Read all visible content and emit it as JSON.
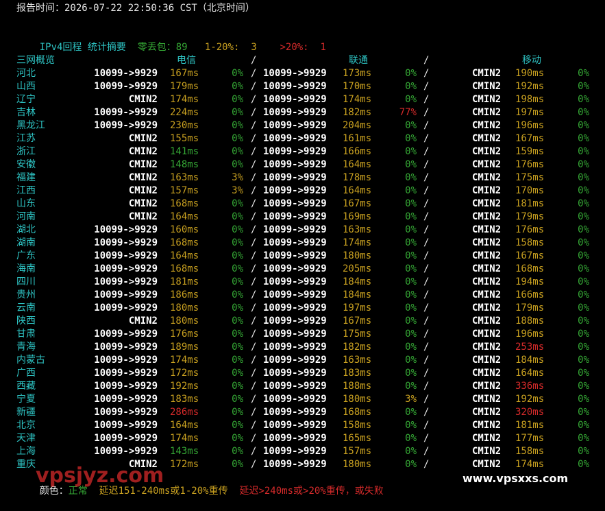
{
  "report_time": "报告时间：2026-07-22 22:50:36 CST（北京时间）",
  "summary": {
    "title": "IPv4回程 统计摘要",
    "zero_loss": "零丢包：89",
    "mid_loss": "1-20%:  3",
    "high_loss": ">20%:  1"
  },
  "header": {
    "overview": "三网概览",
    "telecom": "电信",
    "unicom": "联通",
    "mobile": "移动",
    "sep": "/"
  },
  "colors": {
    "background": "#000000",
    "cyan": "#2ec4c4",
    "green": "#35a835",
    "yellow": "#c8a020",
    "red": "#d42a2a",
    "white": "#ffffff"
  },
  "rows": [
    {
      "prov": "河北",
      "t_route": "10099->9929",
      "t_ms": "167ms",
      "t_ms_c": "yellow",
      "t_loss": "0%",
      "t_loss_c": "green",
      "u_route": "10099->9929",
      "u_ms": "173ms",
      "u_ms_c": "yellow",
      "u_loss": "0%",
      "u_loss_c": "green",
      "m_route": "CMIN2",
      "m_ms": "190ms",
      "m_ms_c": "yellow",
      "m_loss": "0%",
      "m_loss_c": "green"
    },
    {
      "prov": "山西",
      "t_route": "10099->9929",
      "t_ms": "179ms",
      "t_ms_c": "yellow",
      "t_loss": "0%",
      "t_loss_c": "green",
      "u_route": "10099->9929",
      "u_ms": "170ms",
      "u_ms_c": "yellow",
      "u_loss": "0%",
      "u_loss_c": "green",
      "m_route": "CMIN2",
      "m_ms": "192ms",
      "m_ms_c": "yellow",
      "m_loss": "0%",
      "m_loss_c": "green"
    },
    {
      "prov": "辽宁",
      "t_route": "CMIN2",
      "t_ms": "174ms",
      "t_ms_c": "yellow",
      "t_loss": "0%",
      "t_loss_c": "green",
      "u_route": "10099->9929",
      "u_ms": "174ms",
      "u_ms_c": "yellow",
      "u_loss": "0%",
      "u_loss_c": "green",
      "m_route": "CMIN2",
      "m_ms": "198ms",
      "m_ms_c": "yellow",
      "m_loss": "0%",
      "m_loss_c": "green"
    },
    {
      "prov": "吉林",
      "t_route": "10099->9929",
      "t_ms": "224ms",
      "t_ms_c": "yellow",
      "t_loss": "0%",
      "t_loss_c": "green",
      "u_route": "10099->9929",
      "u_ms": "182ms",
      "u_ms_c": "yellow",
      "u_loss": "77%",
      "u_loss_c": "red",
      "m_route": "CMIN2",
      "m_ms": "197ms",
      "m_ms_c": "yellow",
      "m_loss": "0%",
      "m_loss_c": "green"
    },
    {
      "prov": "黑龙江",
      "t_route": "10099->9929",
      "t_ms": "230ms",
      "t_ms_c": "yellow",
      "t_loss": "0%",
      "t_loss_c": "green",
      "u_route": "10099->9929",
      "u_ms": "204ms",
      "u_ms_c": "yellow",
      "u_loss": "0%",
      "u_loss_c": "green",
      "m_route": "CMIN2",
      "m_ms": "196ms",
      "m_ms_c": "yellow",
      "m_loss": "0%",
      "m_loss_c": "green"
    },
    {
      "prov": "江苏",
      "t_route": "CMIN2",
      "t_ms": "155ms",
      "t_ms_c": "yellow",
      "t_loss": "0%",
      "t_loss_c": "green",
      "u_route": "10099->9929",
      "u_ms": "161ms",
      "u_ms_c": "yellow",
      "u_loss": "0%",
      "u_loss_c": "green",
      "m_route": "CMIN2",
      "m_ms": "167ms",
      "m_ms_c": "yellow",
      "m_loss": "0%",
      "m_loss_c": "green"
    },
    {
      "prov": "浙江",
      "t_route": "CMIN2",
      "t_ms": "141ms",
      "t_ms_c": "green",
      "t_loss": "0%",
      "t_loss_c": "green",
      "u_route": "10099->9929",
      "u_ms": "166ms",
      "u_ms_c": "yellow",
      "u_loss": "0%",
      "u_loss_c": "green",
      "m_route": "CMIN2",
      "m_ms": "159ms",
      "m_ms_c": "yellow",
      "m_loss": "0%",
      "m_loss_c": "green"
    },
    {
      "prov": "安徽",
      "t_route": "CMIN2",
      "t_ms": "148ms",
      "t_ms_c": "green",
      "t_loss": "0%",
      "t_loss_c": "green",
      "u_route": "10099->9929",
      "u_ms": "164ms",
      "u_ms_c": "yellow",
      "u_loss": "0%",
      "u_loss_c": "green",
      "m_route": "CMIN2",
      "m_ms": "176ms",
      "m_ms_c": "yellow",
      "m_loss": "0%",
      "m_loss_c": "green"
    },
    {
      "prov": "福建",
      "t_route": "CMIN2",
      "t_ms": "163ms",
      "t_ms_c": "yellow",
      "t_loss": "3%",
      "t_loss_c": "yellow",
      "u_route": "10099->9929",
      "u_ms": "178ms",
      "u_ms_c": "yellow",
      "u_loss": "0%",
      "u_loss_c": "green",
      "m_route": "CMIN2",
      "m_ms": "175ms",
      "m_ms_c": "yellow",
      "m_loss": "0%",
      "m_loss_c": "green"
    },
    {
      "prov": "江西",
      "t_route": "CMIN2",
      "t_ms": "157ms",
      "t_ms_c": "yellow",
      "t_loss": "3%",
      "t_loss_c": "yellow",
      "u_route": "10099->9929",
      "u_ms": "164ms",
      "u_ms_c": "yellow",
      "u_loss": "0%",
      "u_loss_c": "green",
      "m_route": "CMIN2",
      "m_ms": "170ms",
      "m_ms_c": "yellow",
      "m_loss": "0%",
      "m_loss_c": "green"
    },
    {
      "prov": "山东",
      "t_route": "CMIN2",
      "t_ms": "168ms",
      "t_ms_c": "yellow",
      "t_loss": "0%",
      "t_loss_c": "green",
      "u_route": "10099->9929",
      "u_ms": "167ms",
      "u_ms_c": "yellow",
      "u_loss": "0%",
      "u_loss_c": "green",
      "m_route": "CMIN2",
      "m_ms": "181ms",
      "m_ms_c": "yellow",
      "m_loss": "0%",
      "m_loss_c": "green"
    },
    {
      "prov": "河南",
      "t_route": "CMIN2",
      "t_ms": "164ms",
      "t_ms_c": "yellow",
      "t_loss": "0%",
      "t_loss_c": "green",
      "u_route": "10099->9929",
      "u_ms": "169ms",
      "u_ms_c": "yellow",
      "u_loss": "0%",
      "u_loss_c": "green",
      "m_route": "CMIN2",
      "m_ms": "179ms",
      "m_ms_c": "yellow",
      "m_loss": "0%",
      "m_loss_c": "green"
    },
    {
      "prov": "湖北",
      "t_route": "10099->9929",
      "t_ms": "160ms",
      "t_ms_c": "yellow",
      "t_loss": "0%",
      "t_loss_c": "green",
      "u_route": "10099->9929",
      "u_ms": "163ms",
      "u_ms_c": "yellow",
      "u_loss": "0%",
      "u_loss_c": "green",
      "m_route": "CMIN2",
      "m_ms": "176ms",
      "m_ms_c": "yellow",
      "m_loss": "0%",
      "m_loss_c": "green"
    },
    {
      "prov": "湖南",
      "t_route": "10099->9929",
      "t_ms": "168ms",
      "t_ms_c": "yellow",
      "t_loss": "0%",
      "t_loss_c": "green",
      "u_route": "10099->9929",
      "u_ms": "174ms",
      "u_ms_c": "yellow",
      "u_loss": "0%",
      "u_loss_c": "green",
      "m_route": "CMIN2",
      "m_ms": "158ms",
      "m_ms_c": "yellow",
      "m_loss": "0%",
      "m_loss_c": "green"
    },
    {
      "prov": "广东",
      "t_route": "10099->9929",
      "t_ms": "164ms",
      "t_ms_c": "yellow",
      "t_loss": "0%",
      "t_loss_c": "green",
      "u_route": "10099->9929",
      "u_ms": "180ms",
      "u_ms_c": "yellow",
      "u_loss": "0%",
      "u_loss_c": "green",
      "m_route": "CMIN2",
      "m_ms": "167ms",
      "m_ms_c": "yellow",
      "m_loss": "0%",
      "m_loss_c": "green"
    },
    {
      "prov": "海南",
      "t_route": "10099->9929",
      "t_ms": "168ms",
      "t_ms_c": "yellow",
      "t_loss": "0%",
      "t_loss_c": "green",
      "u_route": "10099->9929",
      "u_ms": "205ms",
      "u_ms_c": "yellow",
      "u_loss": "0%",
      "u_loss_c": "green",
      "m_route": "CMIN2",
      "m_ms": "168ms",
      "m_ms_c": "yellow",
      "m_loss": "0%",
      "m_loss_c": "green"
    },
    {
      "prov": "四川",
      "t_route": "10099->9929",
      "t_ms": "181ms",
      "t_ms_c": "yellow",
      "t_loss": "0%",
      "t_loss_c": "green",
      "u_route": "10099->9929",
      "u_ms": "184ms",
      "u_ms_c": "yellow",
      "u_loss": "0%",
      "u_loss_c": "green",
      "m_route": "CMIN2",
      "m_ms": "194ms",
      "m_ms_c": "yellow",
      "m_loss": "0%",
      "m_loss_c": "green"
    },
    {
      "prov": "贵州",
      "t_route": "10099->9929",
      "t_ms": "186ms",
      "t_ms_c": "yellow",
      "t_loss": "0%",
      "t_loss_c": "green",
      "u_route": "10099->9929",
      "u_ms": "184ms",
      "u_ms_c": "yellow",
      "u_loss": "0%",
      "u_loss_c": "green",
      "m_route": "CMIN2",
      "m_ms": "166ms",
      "m_ms_c": "yellow",
      "m_loss": "0%",
      "m_loss_c": "green"
    },
    {
      "prov": "云南",
      "t_route": "10099->9929",
      "t_ms": "180ms",
      "t_ms_c": "yellow",
      "t_loss": "0%",
      "t_loss_c": "green",
      "u_route": "10099->9929",
      "u_ms": "197ms",
      "u_ms_c": "yellow",
      "u_loss": "0%",
      "u_loss_c": "green",
      "m_route": "CMIN2",
      "m_ms": "179ms",
      "m_ms_c": "yellow",
      "m_loss": "0%",
      "m_loss_c": "green"
    },
    {
      "prov": "陕西",
      "t_route": "CMIN2",
      "t_ms": "180ms",
      "t_ms_c": "yellow",
      "t_loss": "0%",
      "t_loss_c": "green",
      "u_route": "10099->9929",
      "u_ms": "167ms",
      "u_ms_c": "yellow",
      "u_loss": "0%",
      "u_loss_c": "green",
      "m_route": "CMIN2",
      "m_ms": "188ms",
      "m_ms_c": "yellow",
      "m_loss": "0%",
      "m_loss_c": "green"
    },
    {
      "prov": "甘肃",
      "t_route": "10099->9929",
      "t_ms": "176ms",
      "t_ms_c": "yellow",
      "t_loss": "0%",
      "t_loss_c": "green",
      "u_route": "10099->9929",
      "u_ms": "175ms",
      "u_ms_c": "yellow",
      "u_loss": "0%",
      "u_loss_c": "green",
      "m_route": "CMIN2",
      "m_ms": "196ms",
      "m_ms_c": "yellow",
      "m_loss": "0%",
      "m_loss_c": "green"
    },
    {
      "prov": "青海",
      "t_route": "10099->9929",
      "t_ms": "189ms",
      "t_ms_c": "yellow",
      "t_loss": "0%",
      "t_loss_c": "green",
      "u_route": "10099->9929",
      "u_ms": "182ms",
      "u_ms_c": "yellow",
      "u_loss": "0%",
      "u_loss_c": "green",
      "m_route": "CMIN2",
      "m_ms": "253ms",
      "m_ms_c": "red",
      "m_loss": "0%",
      "m_loss_c": "green"
    },
    {
      "prov": "内蒙古",
      "t_route": "10099->9929",
      "t_ms": "174ms",
      "t_ms_c": "yellow",
      "t_loss": "0%",
      "t_loss_c": "green",
      "u_route": "10099->9929",
      "u_ms": "163ms",
      "u_ms_c": "yellow",
      "u_loss": "0%",
      "u_loss_c": "green",
      "m_route": "CMIN2",
      "m_ms": "184ms",
      "m_ms_c": "yellow",
      "m_loss": "0%",
      "m_loss_c": "green"
    },
    {
      "prov": "广西",
      "t_route": "10099->9929",
      "t_ms": "172ms",
      "t_ms_c": "yellow",
      "t_loss": "0%",
      "t_loss_c": "green",
      "u_route": "10099->9929",
      "u_ms": "183ms",
      "u_ms_c": "yellow",
      "u_loss": "0%",
      "u_loss_c": "green",
      "m_route": "CMIN2",
      "m_ms": "164ms",
      "m_ms_c": "yellow",
      "m_loss": "0%",
      "m_loss_c": "green"
    },
    {
      "prov": "西藏",
      "t_route": "10099->9929",
      "t_ms": "192ms",
      "t_ms_c": "yellow",
      "t_loss": "0%",
      "t_loss_c": "green",
      "u_route": "10099->9929",
      "u_ms": "188ms",
      "u_ms_c": "yellow",
      "u_loss": "0%",
      "u_loss_c": "green",
      "m_route": "CMIN2",
      "m_ms": "336ms",
      "m_ms_c": "red",
      "m_loss": "0%",
      "m_loss_c": "green"
    },
    {
      "prov": "宁夏",
      "t_route": "10099->9929",
      "t_ms": "183ms",
      "t_ms_c": "yellow",
      "t_loss": "0%",
      "t_loss_c": "green",
      "u_route": "10099->9929",
      "u_ms": "180ms",
      "u_ms_c": "yellow",
      "u_loss": "3%",
      "u_loss_c": "yellow",
      "m_route": "CMIN2",
      "m_ms": "192ms",
      "m_ms_c": "yellow",
      "m_loss": "0%",
      "m_loss_c": "green"
    },
    {
      "prov": "新疆",
      "t_route": "10099->9929",
      "t_ms": "286ms",
      "t_ms_c": "red",
      "t_loss": "0%",
      "t_loss_c": "green",
      "u_route": "10099->9929",
      "u_ms": "168ms",
      "u_ms_c": "yellow",
      "u_loss": "0%",
      "u_loss_c": "green",
      "m_route": "CMIN2",
      "m_ms": "320ms",
      "m_ms_c": "red",
      "m_loss": "0%",
      "m_loss_c": "green"
    },
    {
      "prov": "北京",
      "t_route": "10099->9929",
      "t_ms": "164ms",
      "t_ms_c": "yellow",
      "t_loss": "0%",
      "t_loss_c": "green",
      "u_route": "10099->9929",
      "u_ms": "158ms",
      "u_ms_c": "yellow",
      "u_loss": "0%",
      "u_loss_c": "green",
      "m_route": "CMIN2",
      "m_ms": "181ms",
      "m_ms_c": "yellow",
      "m_loss": "0%",
      "m_loss_c": "green"
    },
    {
      "prov": "天津",
      "t_route": "10099->9929",
      "t_ms": "174ms",
      "t_ms_c": "yellow",
      "t_loss": "0%",
      "t_loss_c": "green",
      "u_route": "10099->9929",
      "u_ms": "165ms",
      "u_ms_c": "yellow",
      "u_loss": "0%",
      "u_loss_c": "green",
      "m_route": "CMIN2",
      "m_ms": "177ms",
      "m_ms_c": "yellow",
      "m_loss": "0%",
      "m_loss_c": "green"
    },
    {
      "prov": "上海",
      "t_route": "10099->9929",
      "t_ms": "143ms",
      "t_ms_c": "green",
      "t_loss": "0%",
      "t_loss_c": "green",
      "u_route": "10099->9929",
      "u_ms": "157ms",
      "u_ms_c": "yellow",
      "u_loss": "0%",
      "u_loss_c": "green",
      "m_route": "CMIN2",
      "m_ms": "158ms",
      "m_ms_c": "yellow",
      "m_loss": "0%",
      "m_loss_c": "green"
    },
    {
      "prov": "重庆",
      "t_route": "CMIN2",
      "t_ms": "172ms",
      "t_ms_c": "yellow",
      "t_loss": "0%",
      "t_loss_c": "green",
      "u_route": "10099->9929",
      "u_ms": "180ms",
      "u_ms_c": "yellow",
      "u_loss": "0%",
      "u_loss_c": "green",
      "m_route": "CMIN2",
      "m_ms": "174ms",
      "m_ms_c": "yellow",
      "m_loss": "0%",
      "m_loss_c": "green"
    }
  ],
  "legend": {
    "label": "颜色：",
    "green_text": "正常",
    "yellow_text": "延迟151-240ms或1-20%重传",
    "red_text": "延迟>240ms或>20%重传，或失败"
  },
  "watermarks": {
    "left": "vpsjyz.com",
    "right": "www.vpsxxs.com"
  }
}
